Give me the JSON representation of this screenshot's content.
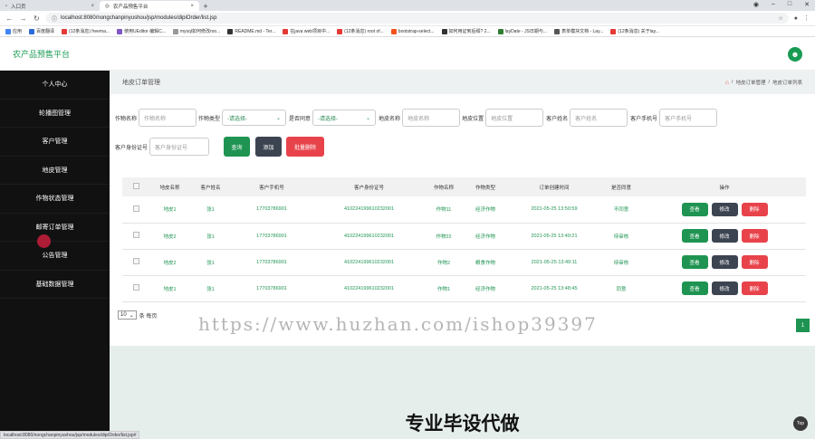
{
  "browser": {
    "tabs": [
      {
        "title": "入口页",
        "active": false
      },
      {
        "title": "农产品预售平台",
        "active": true
      }
    ],
    "url": "localhost:8080/nongchanpinyushou/jsp/modules/dipiOrder/list.jsp",
    "bookmarks": [
      {
        "label": "应用",
        "color": "#4285f4"
      },
      {
        "label": "百度翻译",
        "color": "#2a6bd4"
      },
      {
        "label": "(12条消息) freema...",
        "color": "#e53935"
      },
      {
        "label": "使用UEditor 编辑C...",
        "color": "#7e57c2"
      },
      {
        "label": "mysql如何修改roo...",
        "color": "#999999"
      },
      {
        "label": "README.md - Ter...",
        "color": "#333333"
      },
      {
        "label": "在java web项目中...",
        "color": "#e53935"
      },
      {
        "label": "(12条消息) root of...",
        "color": "#e53935"
      },
      {
        "label": "bootstrap-select...",
        "color": "#f4511e"
      },
      {
        "label": "如何用证到后缀? 2...",
        "color": "#333333"
      },
      {
        "label": "layDate - JS日期与...",
        "color": "#2e7d32"
      },
      {
        "label": "表单模块文档 - Lay...",
        "color": "#555555"
      },
      {
        "label": "(12条消息) 关于lay...",
        "color": "#e53935"
      }
    ],
    "status_url": "localhost:8080/nongchanpinyushou/jsp/modules/dipiOrder/list.jsp#"
  },
  "header": {
    "brand": "农产品预售平台"
  },
  "sidebar": {
    "items": [
      {
        "label": "个人中心"
      },
      {
        "label": "轮播图管理"
      },
      {
        "label": "客户管理"
      },
      {
        "label": "地皮管理"
      },
      {
        "label": "作物状态管理"
      },
      {
        "label": "邮寄订单管理"
      },
      {
        "label": "公告管理"
      },
      {
        "label": "基础数据管理"
      }
    ]
  },
  "page": {
    "title": "地皮订单管理",
    "breadcrumb": [
      "地皮订单管理",
      "地皮订单列表"
    ]
  },
  "search": {
    "crop_name_label": "作物名称",
    "crop_name_placeholder": "作物名称",
    "crop_type_label": "作物类型",
    "crop_type_value": "-请选择-",
    "agree_label": "是否同意",
    "agree_value": "-请选择-",
    "land_name_label": "地皮名称",
    "land_name_placeholder": "地皮名称",
    "land_loc_label": "地皮位置",
    "land_loc_placeholder": "地皮位置",
    "cust_name_label": "客户姓名",
    "cust_name_placeholder": "客户姓名",
    "cust_phone_label": "客户手机号",
    "cust_phone_placeholder": "客户手机号",
    "cust_id_label": "客户身份证号",
    "cust_id_placeholder": "客户身份证号",
    "query_btn": "查询",
    "add_btn": "添加",
    "batch_delete_btn": "批量删除"
  },
  "table": {
    "headers": [
      "地皮名称",
      "客户姓名",
      "客户手机号",
      "客户身份证号",
      "作物名称",
      "作物类型",
      "订单创建时间",
      "是否同意",
      "操作"
    ],
    "rows": [
      [
        "地皮1",
        "张1",
        "17703786901",
        "410224199610232001",
        "作物11",
        "经济作物",
        "2021-05-25 13:50:59",
        "不同意"
      ],
      [
        "地皮2",
        "张1",
        "17703786901",
        "410224199610232001",
        "作物22",
        "经济作物",
        "2021-05-25 13:49:21",
        "待审核"
      ],
      [
        "地皮2",
        "张1",
        "17703786901",
        "410224199610232001",
        "作物2",
        "粮食作物",
        "2021-05-25 13:49:11",
        "待审核"
      ],
      [
        "地皮1",
        "张1",
        "17703786901",
        "410224199610232001",
        "作物1",
        "经济作物",
        "2021-05-25 13:48:45",
        "同意"
      ]
    ],
    "actions": {
      "view": "查看",
      "edit": "修改",
      "delete": "删除"
    }
  },
  "pager": {
    "page_size": "10",
    "per_page_text": "条 每页",
    "current_page": "1"
  },
  "watermark": "https://www.huzhan.com/ishop39397",
  "banner": {
    "text": "专业毕设代做",
    "top_label": "Top"
  }
}
